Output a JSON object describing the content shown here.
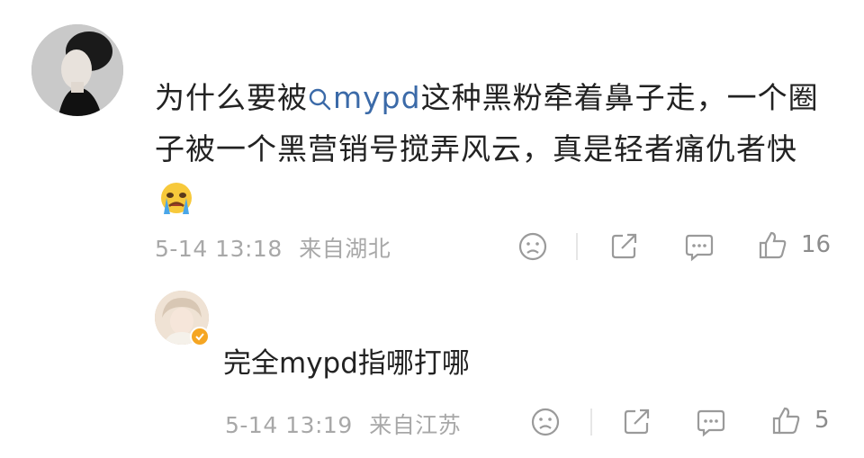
{
  "comment": {
    "text_before": "为什么要被",
    "mention": "mypd",
    "text_after": "这种黑粉牵着鼻子走，一个圈子被一个黑营销号搅弄风云，真是轻者痛仇者快",
    "emoji": "loudly-crying-face",
    "date": "5-14 13:18",
    "location": "来自湖北",
    "likes": "16"
  },
  "reply": {
    "text": "完全mypd指哪打哪",
    "date": "5-14 13:19",
    "location": "来自江苏",
    "likes": "5"
  },
  "colors": {
    "mention": "#3b6aa8",
    "meta": "#a8a8a8",
    "icon": "#9a9a9a",
    "badge": "#f5a623"
  },
  "icons": [
    "search-icon",
    "dislike-icon",
    "share-icon",
    "comment-icon",
    "like-icon",
    "verified-badge-icon"
  ]
}
